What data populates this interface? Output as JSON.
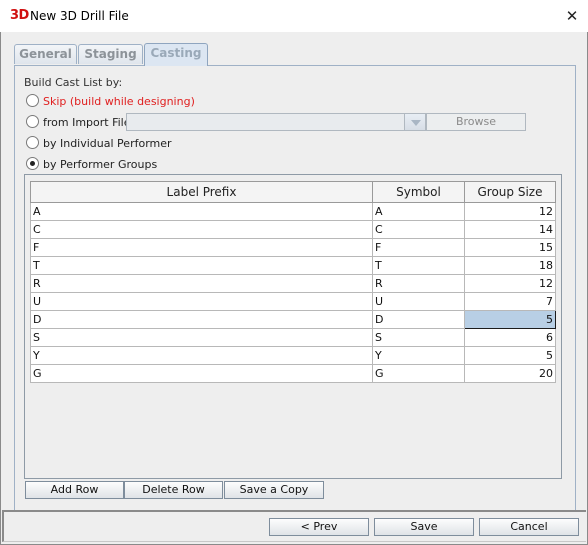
{
  "window": {
    "logo": "3D",
    "title": "New 3D Drill File",
    "close_glyph": "✕"
  },
  "tabs": [
    {
      "label": "General",
      "active": false
    },
    {
      "label": "Staging",
      "active": false
    },
    {
      "label": "Casting",
      "active": true
    }
  ],
  "casting": {
    "build_label": "Build Cast List by:",
    "options": [
      {
        "label": "Skip (build while designing)",
        "checked": false
      },
      {
        "label": "from Import File",
        "checked": false
      },
      {
        "label": "by Individual Performer",
        "checked": false
      },
      {
        "label": "by Performer Groups",
        "checked": true
      }
    ],
    "import_file_value": "",
    "browse_label": "Browse",
    "table": {
      "columns": [
        "Label Prefix",
        "Symbol",
        "Group Size"
      ],
      "rows": [
        {
          "prefix": "A",
          "symbol": "A",
          "size": "12"
        },
        {
          "prefix": "C",
          "symbol": "C",
          "size": "14"
        },
        {
          "prefix": "F",
          "symbol": "F",
          "size": "15"
        },
        {
          "prefix": "T",
          "symbol": "T",
          "size": "18"
        },
        {
          "prefix": "R",
          "symbol": "R",
          "size": "12"
        },
        {
          "prefix": "U",
          "symbol": "U",
          "size": "7"
        },
        {
          "prefix": "D",
          "symbol": "D",
          "size": "5"
        },
        {
          "prefix": "S",
          "symbol": "S",
          "size": "6"
        },
        {
          "prefix": "Y",
          "symbol": "Y",
          "size": "5"
        },
        {
          "prefix": "G",
          "symbol": "G",
          "size": "20"
        }
      ],
      "selected_row": 6
    },
    "add_row_label": "Add Row",
    "delete_row_label": "Delete Row",
    "save_copy_label": "Save a Copy"
  },
  "footer": {
    "prev_label": "< Prev",
    "save_label": "Save",
    "cancel_label": "Cancel"
  },
  "colors": {
    "skip_option": "#e02020",
    "logo": "#d01010",
    "selection": "#b8cfe5"
  }
}
